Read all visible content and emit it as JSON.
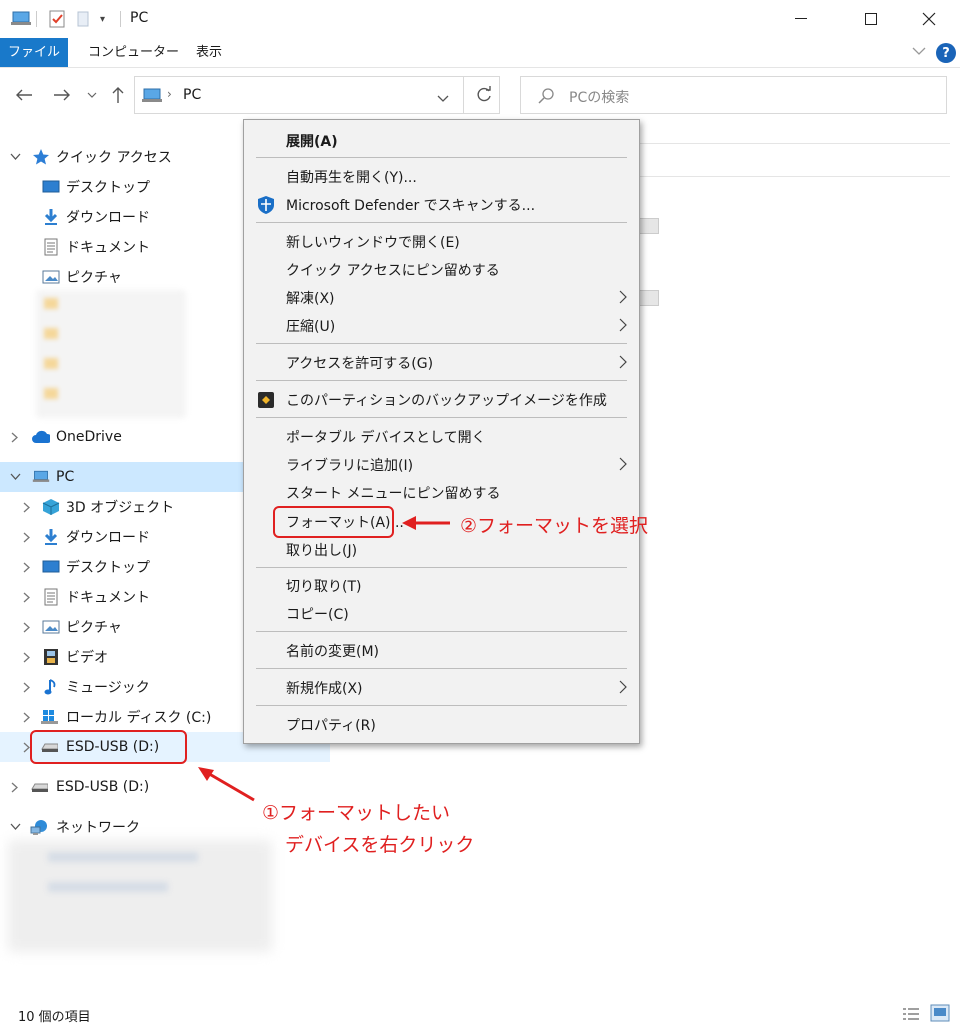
{
  "window": {
    "title": "PC"
  },
  "ribbon": {
    "tabs": [
      "ファイル",
      "コンピューター",
      "表示"
    ]
  },
  "address": {
    "location": "PC",
    "search_placeholder": "PCの検索"
  },
  "sidebar": {
    "quick_access": {
      "label": "クイック アクセス",
      "items": [
        "デスクトップ",
        "ダウンロード",
        "ドキュメント",
        "ピクチャ"
      ]
    },
    "onedrive": "OneDrive",
    "pc": {
      "label": "PC",
      "items": [
        "3D オブジェクト",
        "ダウンロード",
        "デスクトップ",
        "ドキュメント",
        "ピクチャ",
        "ビデオ",
        "ミュージック",
        "ローカル ディスク (C:)",
        "ESD-USB (D:)"
      ]
    },
    "usb_root": "ESD-USB (D:)",
    "network": "ネットワーク"
  },
  "context_menu": {
    "items": [
      {
        "label": "展開(A)",
        "bold": true
      },
      {
        "label": "自動再生を開く(Y)..."
      },
      {
        "label": "Microsoft Defender でスキャンする...",
        "icon": "defender-shield-icon"
      },
      {
        "label": "新しいウィンドウで開く(E)"
      },
      {
        "label": "クイック アクセスにピン留めする"
      },
      {
        "label": "解凍(X)",
        "submenu": true
      },
      {
        "label": "圧縮(U)",
        "submenu": true
      },
      {
        "label": "アクセスを許可する(G)",
        "submenu": true
      },
      {
        "label": "このパーティションのバックアップイメージを作成",
        "icon": "backup-app-icon"
      },
      {
        "label": "ポータブル デバイスとして開く"
      },
      {
        "label": "ライブラリに追加(I)",
        "submenu": true
      },
      {
        "label": "スタート メニューにピン留めする"
      },
      {
        "label": "フォーマット(A)..."
      },
      {
        "label": "取り出し(J)"
      },
      {
        "label": "切り取り(T)"
      },
      {
        "label": "コピー(C)"
      },
      {
        "label": "名前の変更(M)"
      },
      {
        "label": "新規作成(X)",
        "submenu": true
      },
      {
        "label": "プロパティ(R)"
      }
    ]
  },
  "annotations": {
    "step1_line1": "①フォーマットしたい",
    "step1_line2": "デバイスを右クリック",
    "step2": "②フォーマットを選択"
  },
  "status": {
    "item_count": "10 個の項目"
  },
  "colors": {
    "accent": "#1979ca",
    "selection": "#cce8ff",
    "annotation": "#e02020"
  }
}
